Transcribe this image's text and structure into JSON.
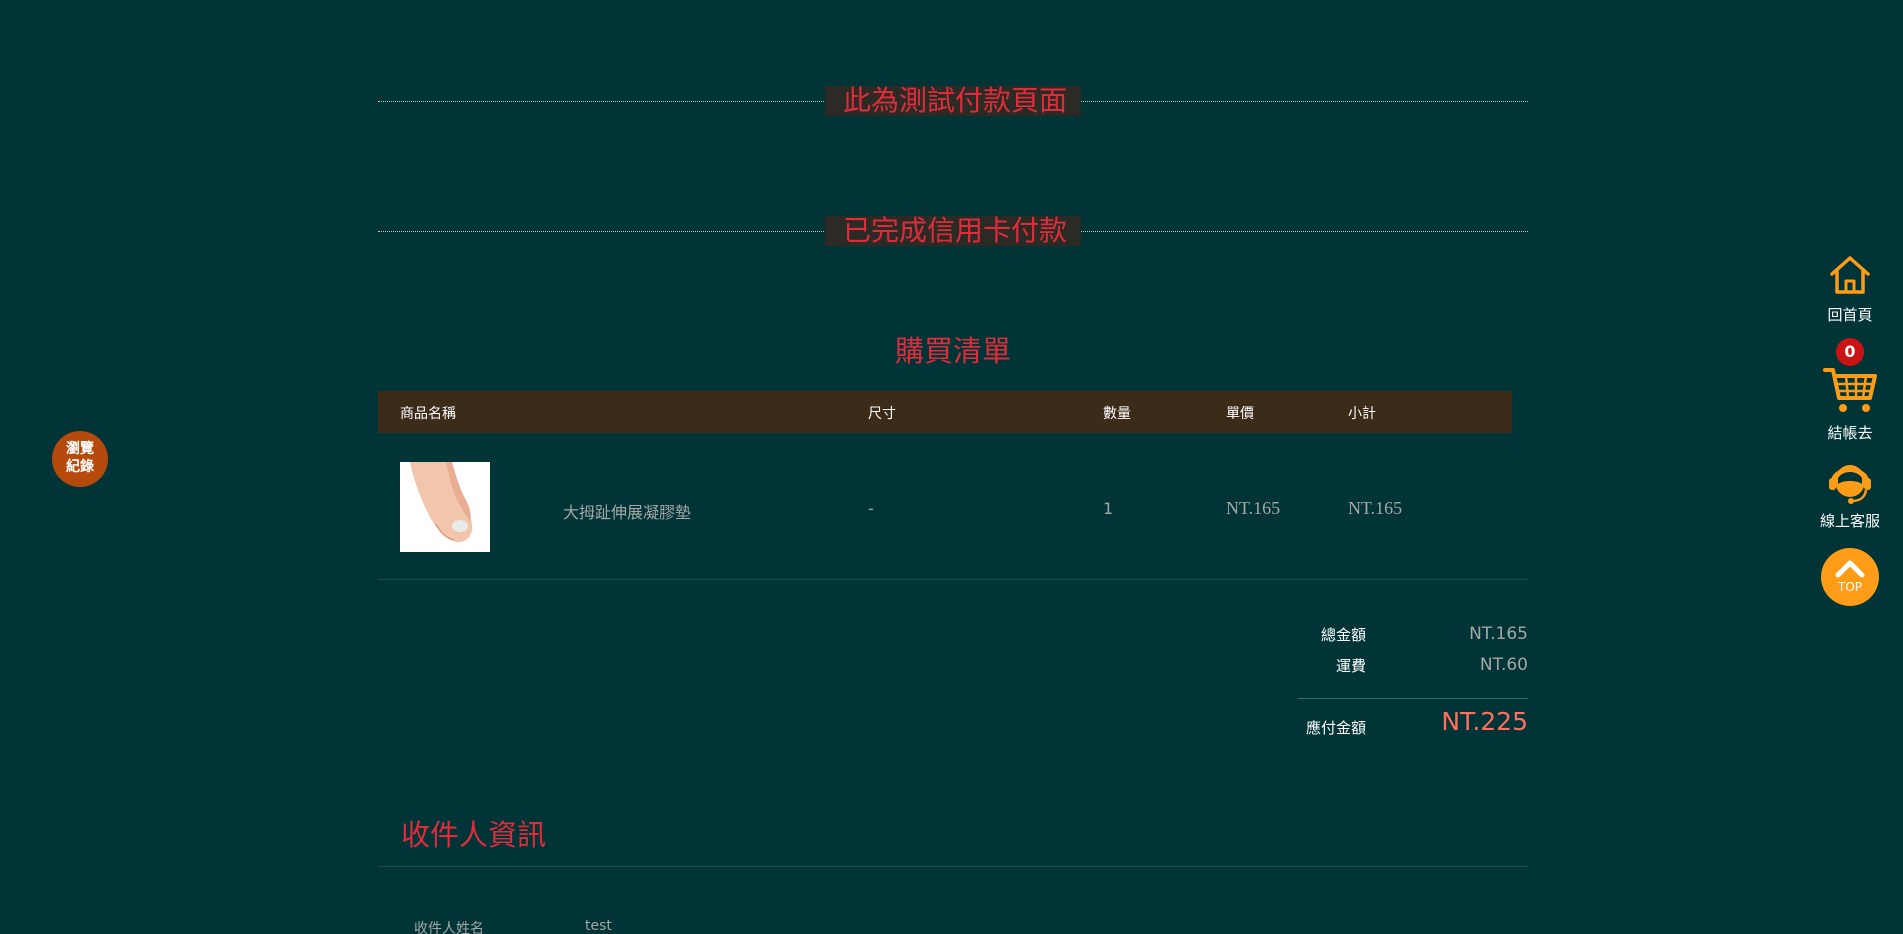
{
  "dividers": {
    "test_notice": "此為測試付款頁面",
    "payment_done": "已完成信用卡付款"
  },
  "purchase": {
    "title": "購買清單",
    "columns": {
      "name": "商品名稱",
      "size": "尺寸",
      "qty": "數量",
      "price": "單價",
      "subtotal": "小計"
    },
    "items": [
      {
        "name": "大拇趾伸展凝膠墊",
        "size": "-",
        "qty": "1",
        "price": "NT.165",
        "subtotal": "NT.165"
      }
    ]
  },
  "totals": {
    "total_label": "總金額",
    "total_value": "NT.165",
    "shipping_label": "運費",
    "shipping_value": "NT.60",
    "due_label": "應付金額",
    "due_value": "NT.225"
  },
  "recipient": {
    "title": "收件人資訊",
    "name_label": "收件人姓名",
    "name_value": "test"
  },
  "float_left": {
    "history_label": "瀏覽紀錄"
  },
  "sidebar": {
    "home_label": "回首頁",
    "cart_count": "0",
    "checkout_label": "結帳去",
    "support_label": "線上客服",
    "top_label": "TOP",
    "accent_color": "#ff9c17"
  }
}
